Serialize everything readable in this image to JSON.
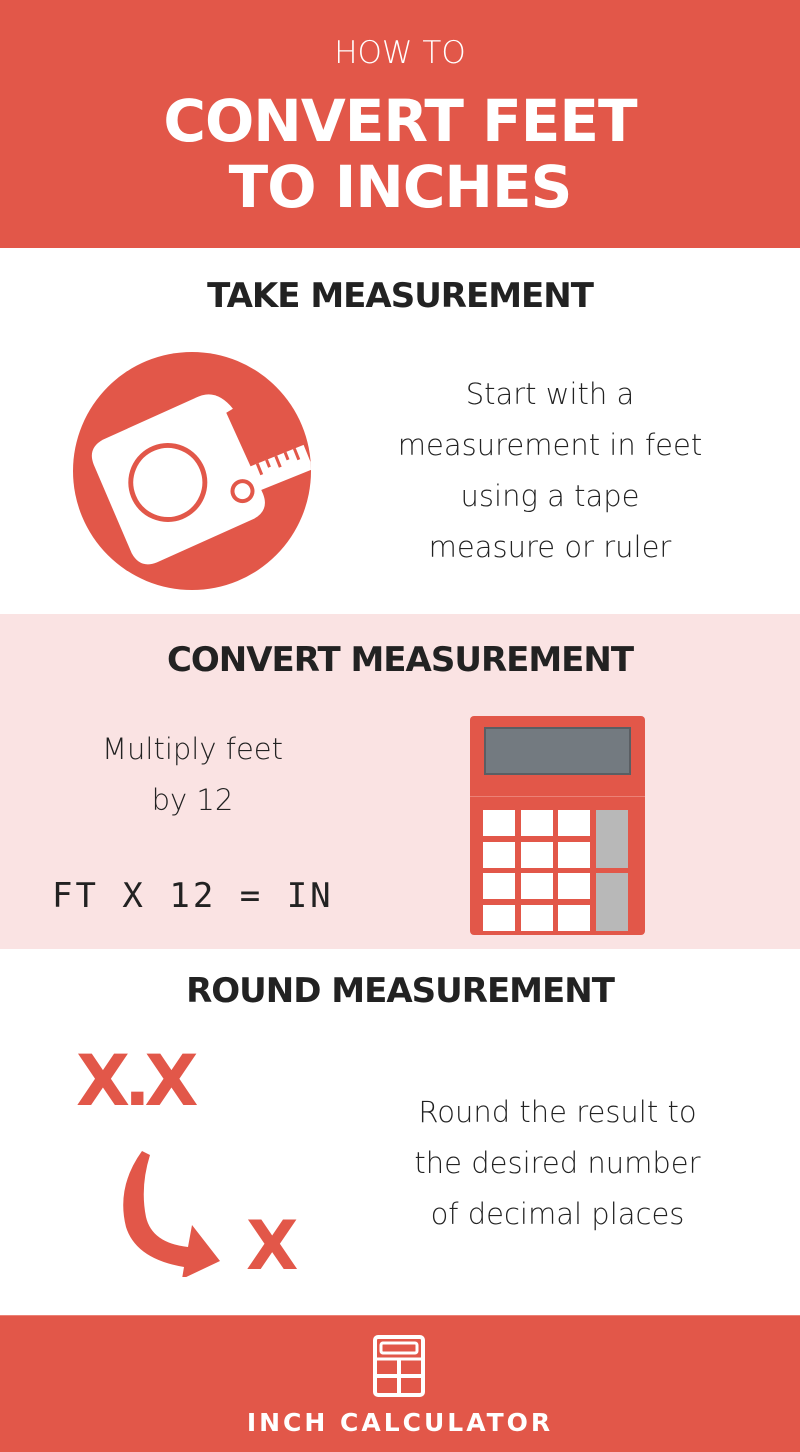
{
  "header": {
    "kicker": "HOW TO",
    "title_line1": "CONVERT FEET",
    "title_line2": "TO INCHES"
  },
  "steps": [
    {
      "title": "TAKE MEASUREMENT",
      "icon": "tape-measure-icon",
      "lines": [
        "Start with a",
        "measurement in feet",
        "using a tape",
        "measure or ruler"
      ]
    },
    {
      "title": "CONVERT MEASUREMENT",
      "icon": "calculator-icon",
      "lines": [
        "Multiply feet",
        "by 12"
      ],
      "formula": "FT X 12 = IN"
    },
    {
      "title": "ROUND MEASUREMENT",
      "icon": "rounding-arrow-icon",
      "from_label": "X.X",
      "to_label": "X",
      "lines": [
        "Round the result to",
        "the desired number",
        "of decimal places"
      ]
    }
  ],
  "footer": {
    "brand": "INCH CALCULATOR",
    "icon": "calculator-icon"
  },
  "colors": {
    "accent": "#e25749",
    "tint": "#fae3e3",
    "text": "#222222",
    "white": "#ffffff"
  }
}
